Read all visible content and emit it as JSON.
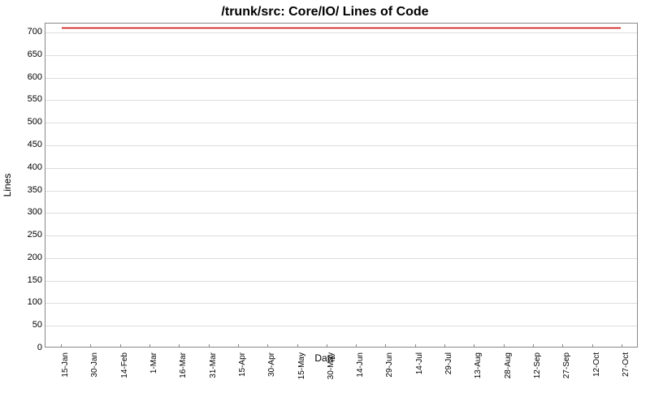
{
  "chart_data": {
    "type": "line",
    "title": "/trunk/src: Core/IO/ Lines of Code",
    "xlabel": "Date",
    "ylabel": "Lines",
    "ylim": [
      0,
      720
    ],
    "yticks": [
      0,
      50,
      100,
      150,
      200,
      250,
      300,
      350,
      400,
      450,
      500,
      550,
      600,
      650,
      700
    ],
    "categories": [
      "15-Jan",
      "30-Jan",
      "14-Feb",
      "1-Mar",
      "16-Mar",
      "31-Mar",
      "15-Apr",
      "30-Apr",
      "15-May",
      "30-May",
      "14-Jun",
      "29-Jun",
      "14-Jul",
      "29-Jul",
      "13-Aug",
      "28-Aug",
      "12-Sep",
      "27-Sep",
      "12-Oct",
      "27-Oct"
    ],
    "series": [
      {
        "name": "Lines of Code",
        "color": "#cc0000",
        "values": [
          710,
          710,
          710,
          710,
          710,
          710,
          710,
          710,
          710,
          710,
          710,
          710,
          710,
          710,
          710,
          710,
          710,
          710,
          710,
          710
        ]
      }
    ]
  }
}
